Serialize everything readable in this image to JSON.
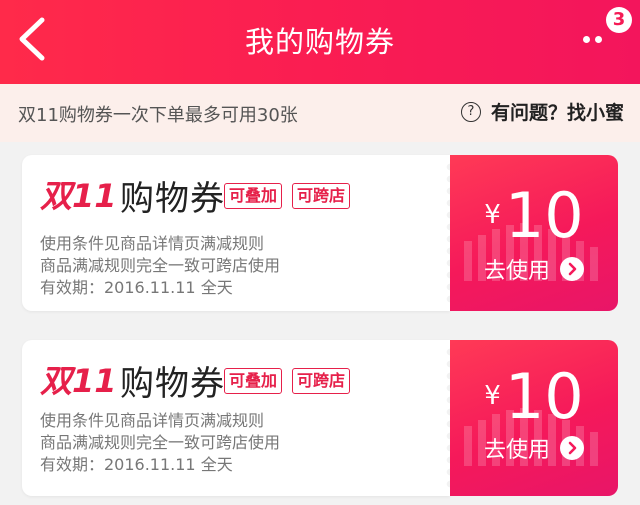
{
  "header": {
    "title": "我的购物券",
    "back_icon": "chevron-left-icon",
    "more_icon": "more-dots-icon",
    "badge_count": "3",
    "bg_color": "#fa1d52"
  },
  "notice": {
    "text": "双11购物券一次下单最多可用30张",
    "help_icon": "?",
    "help_text": "有问题？找小蜜"
  },
  "coupons": [
    {
      "logo": "双11",
      "title": "购物券",
      "tags": [
        "可叠加",
        "可跨店"
      ],
      "desc_1": "使用条件见商品详情页满减规则",
      "desc_2": "商品满减规则完全一致可跨店使用",
      "validity": "有效期：2016.11.11 全天",
      "currency": "¥",
      "amount": "10",
      "action": "去使用"
    },
    {
      "logo": "双11",
      "title": "购物券",
      "tags": [
        "可叠加",
        "可跨店"
      ],
      "desc_1": "使用条件见商品详情页满减规则",
      "desc_2": "商品满减规则完全一致可跨店使用",
      "validity": "有效期：2016.11.11 全天",
      "currency": "¥",
      "amount": "10",
      "action": "去使用"
    }
  ],
  "colors": {
    "accent": "#e6204a",
    "coupon_right": "#f5195a",
    "notice_bg": "#fcefeb"
  }
}
